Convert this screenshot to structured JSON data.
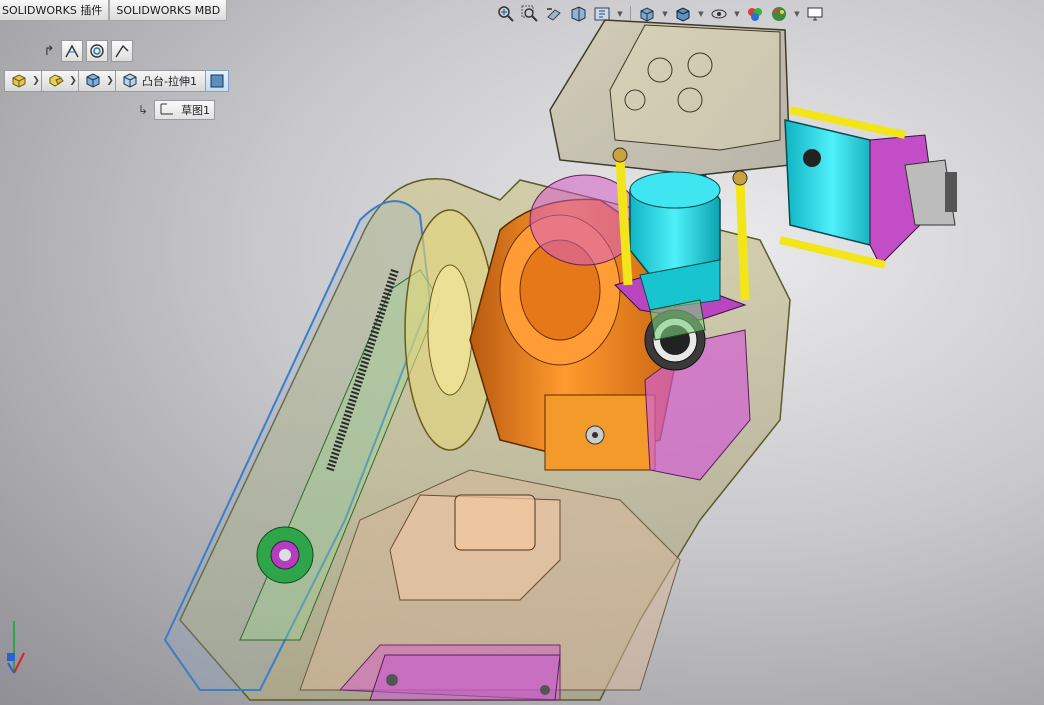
{
  "tabs": [
    {
      "label": "SOLIDWORKS 插件"
    },
    {
      "label": "SOLIDWORKS MBD"
    }
  ],
  "view_toolbar": {
    "icons": [
      "zoom-to-fit-icon",
      "zoom-to-area-icon",
      "previous-view-icon",
      "section-view-icon",
      "view-orientation-icon",
      "display-style-icon",
      "hide-show-items-icon",
      "edit-appearance-icon",
      "apply-scene-icon",
      "view-settings-icon"
    ]
  },
  "sketch_tools": {
    "items": [
      "exit-sketch-icon",
      "smart-dimension-icon",
      "circle-icon",
      "line-icon"
    ]
  },
  "breadcrumb": {
    "items": [
      {
        "icon": "assembly-icon"
      },
      {
        "icon": "part-icon"
      },
      {
        "icon": "body-icon"
      },
      {
        "icon": "solid-body-icon"
      }
    ],
    "feature_label": "凸台-拉伸1",
    "sketch_label": "草图1"
  },
  "colors": {
    "accent": "#1f6fb3",
    "orange_part": "#f08a1e",
    "cyan_part": "#19d3e0",
    "yellow_rod": "#f2e61a",
    "magenta_part": "#c23ac9",
    "housing_tint": "#d8cc6a"
  }
}
